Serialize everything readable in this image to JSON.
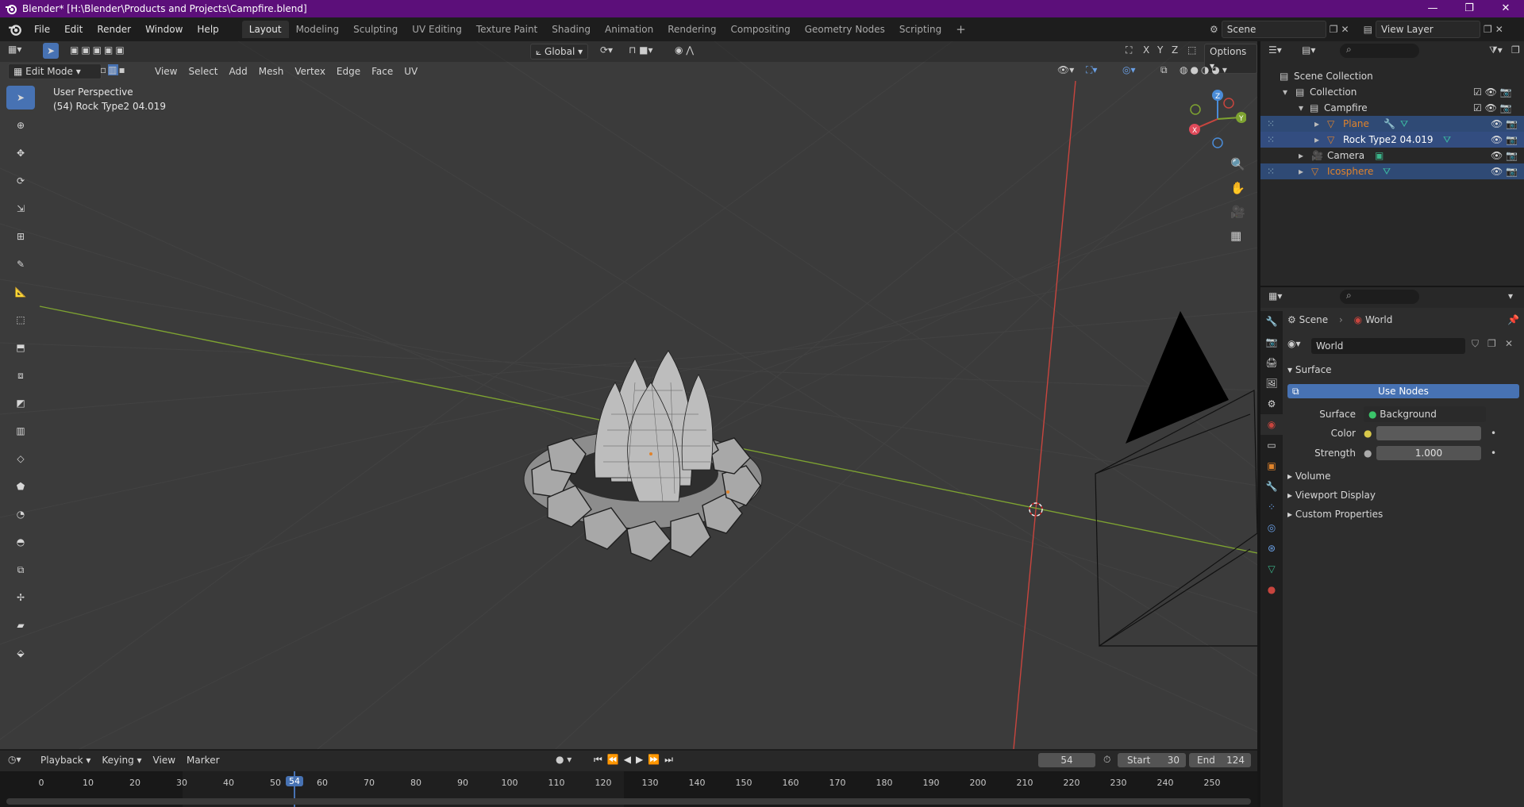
{
  "titlebar": {
    "title": "Blender* [H:\\Blender\\Products and Projects\\Campfire.blend]",
    "min": "—",
    "max": "❐",
    "close": "✕"
  },
  "menu": [
    "File",
    "Edit",
    "Render",
    "Window",
    "Help"
  ],
  "workspaces": [
    "Layout",
    "Modeling",
    "Sculpting",
    "UV Editing",
    "Texture Paint",
    "Shading",
    "Animation",
    "Rendering",
    "Compositing",
    "Geometry Nodes",
    "Scripting"
  ],
  "scene_name": "Scene",
  "view_layer": "View Layer",
  "viewport": {
    "transform_orientation": "Global",
    "mode": "Edit Mode",
    "header_menus": [
      "View",
      "Select",
      "Add",
      "Mesh",
      "Vertex",
      "Edge",
      "Face",
      "UV"
    ],
    "options_label": "Options",
    "axis_x": "X",
    "axis_y": "Y",
    "axis_z": "Z",
    "overlay_line1": "User Perspective",
    "overlay_line2": "(54) Rock Type2 04.019"
  },
  "outliner": {
    "items": [
      {
        "label": "Scene Collection"
      },
      {
        "label": "Collection"
      },
      {
        "label": "Campfire"
      },
      {
        "label": "Plane"
      },
      {
        "label": "Rock Type2 04.019"
      },
      {
        "label": "Camera"
      },
      {
        "label": "Icosphere"
      }
    ]
  },
  "properties": {
    "breadcrumb_scene": "Scene",
    "breadcrumb_world": "World",
    "world_name": "World",
    "surface_panel": "Surface",
    "use_nodes": "Use Nodes",
    "surface_label": "Surface",
    "surface_value": "Background",
    "color_label": "Color",
    "strength_label": "Strength",
    "strength_value": "1.000",
    "panels": [
      "Volume",
      "Viewport Display",
      "Custom Properties"
    ]
  },
  "timeline": {
    "menus": [
      "Playback",
      "Keying",
      "View",
      "Marker"
    ],
    "current_frame": "54",
    "start_label": "Start",
    "start": "30",
    "end_label": "End",
    "end": "124",
    "ticks": [
      "0",
      "10",
      "20",
      "30",
      "40",
      "50",
      "54",
      "60",
      "70",
      "80",
      "90",
      "100",
      "110",
      "120",
      "130",
      "140",
      "150",
      "160",
      "170",
      "180",
      "190",
      "200",
      "210",
      "220",
      "230",
      "240",
      "250"
    ]
  },
  "colors": {
    "accent": "#4772b3",
    "titlebar": "#5c0f7a",
    "x_axis": "#c8453e",
    "y_axis": "#7ea331",
    "selected_orange": "#e0832b"
  }
}
